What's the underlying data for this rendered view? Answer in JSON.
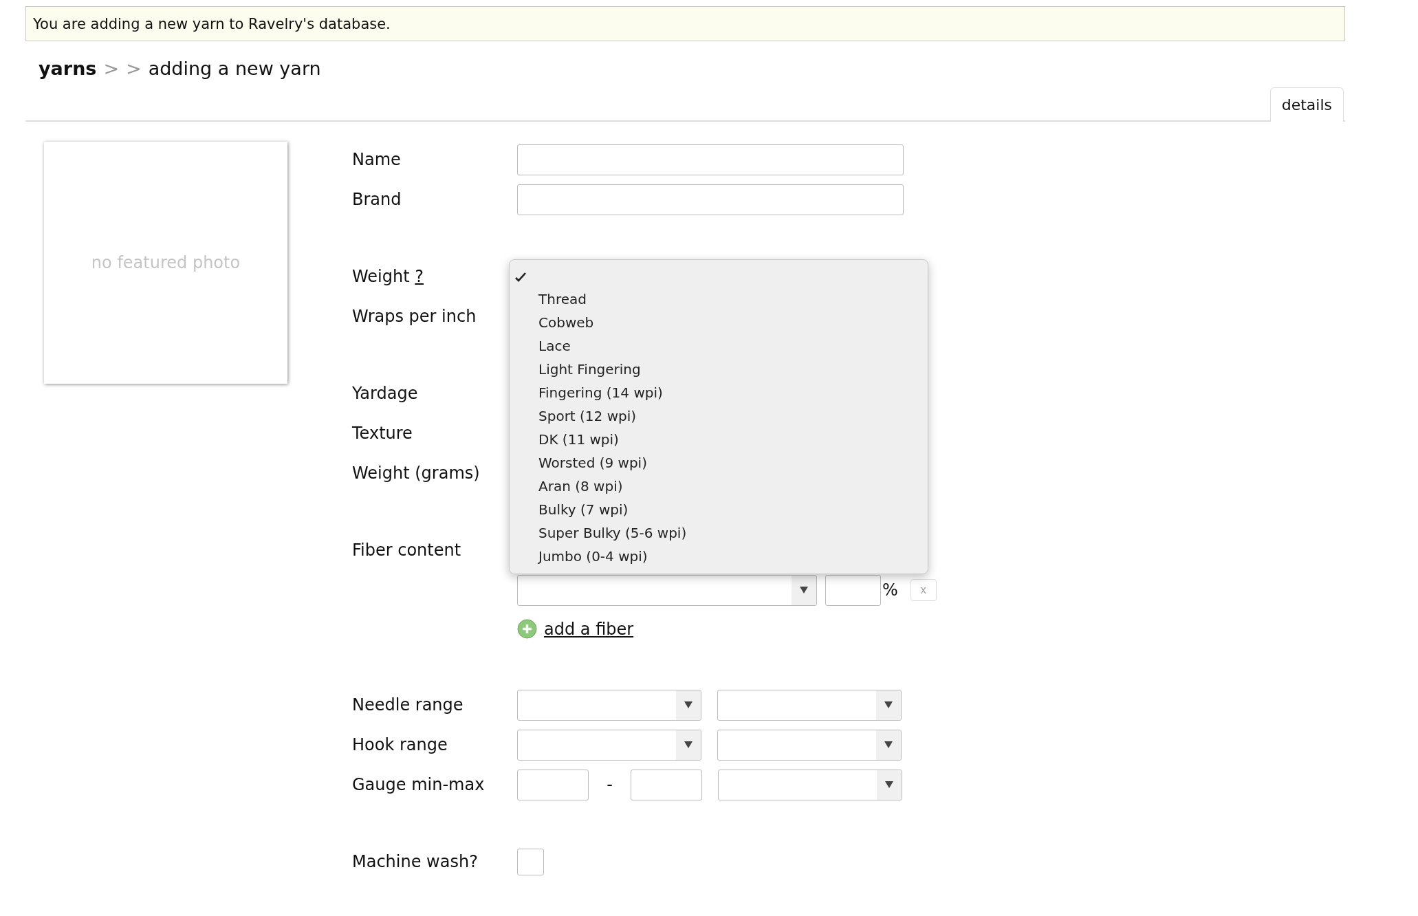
{
  "notice": "You are adding a new yarn to Ravelry's database.",
  "breadcrumb": {
    "root": "yarns",
    "separators": [
      ">",
      ">"
    ],
    "current": "adding a new yarn"
  },
  "tabs": [
    {
      "label": "details",
      "selected": true
    }
  ],
  "photo": {
    "placeholder": "no featured photo"
  },
  "form": {
    "groups": [
      {
        "rows": [
          {
            "label": "Name",
            "kind": "text"
          },
          {
            "label": "Brand",
            "kind": "text"
          }
        ]
      },
      {
        "rows": [
          {
            "label": "Weight",
            "help": "?",
            "kind": "select",
            "open": true,
            "menu": {
              "blank_option": {
                "selected": true
              },
              "options": [
                {
                  "label": "Thread",
                  "selected": false
                },
                {
                  "label": "Cobweb",
                  "selected": false
                },
                {
                  "label": "Lace",
                  "selected": false
                },
                {
                  "label": "Light Fingering",
                  "selected": false
                },
                {
                  "label": "Fingering (14 wpi)",
                  "selected": false
                },
                {
                  "label": "Sport (12 wpi)",
                  "selected": false
                },
                {
                  "label": "DK (11 wpi)",
                  "selected": false
                },
                {
                  "label": "Worsted (9 wpi)",
                  "selected": false
                },
                {
                  "label": "Aran (8 wpi)",
                  "selected": false
                },
                {
                  "label": "Bulky (7 wpi)",
                  "selected": false
                },
                {
                  "label": "Super Bulky (5-6 wpi)",
                  "selected": false
                },
                {
                  "label": "Jumbo (0-4 wpi)",
                  "selected": false
                }
              ]
            }
          },
          {
            "label": "Wraps per inch",
            "kind": "covered"
          }
        ]
      },
      {
        "rows": [
          {
            "label": "Yardage",
            "kind": "covered"
          },
          {
            "label": "Texture",
            "kind": "covered"
          },
          {
            "label": "Weight (grams)",
            "kind": "covered"
          }
        ]
      },
      {
        "rows": [
          {
            "label": "Fiber content",
            "kind": "covered"
          },
          {
            "kind": "fiber",
            "unit": "%",
            "remove": "x"
          },
          {
            "kind": "add",
            "link": "add a fiber"
          }
        ]
      },
      {
        "rows": [
          {
            "label": "Needle range",
            "kind": "select-pair"
          },
          {
            "label": "Hook range",
            "kind": "select-pair"
          },
          {
            "label": "Gauge min-max",
            "kind": "gauge",
            "separator": "-"
          }
        ]
      },
      {
        "rows": [
          {
            "label": "Machine wash?",
            "kind": "checkbox",
            "checked": false
          }
        ]
      }
    ]
  }
}
